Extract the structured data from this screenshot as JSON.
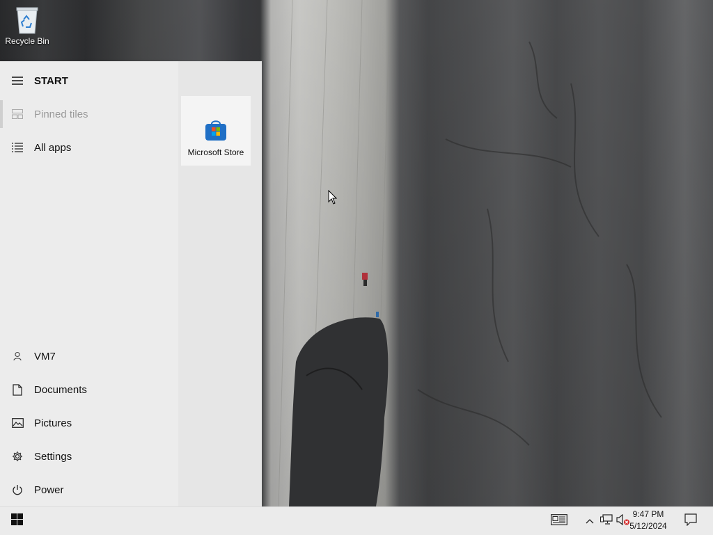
{
  "desktop": {
    "icons": [
      {
        "label": "Recycle Bin",
        "icon": "recycle-bin-icon"
      }
    ]
  },
  "start_menu": {
    "title": "START",
    "items_top": [
      {
        "label": "Pinned tiles",
        "icon": "tiles-icon",
        "state": "disabled"
      },
      {
        "label": "All apps",
        "icon": "list-icon"
      }
    ],
    "items_bottom": [
      {
        "label": "VM7",
        "icon": "user-icon"
      },
      {
        "label": "Documents",
        "icon": "document-icon"
      },
      {
        "label": "Pictures",
        "icon": "picture-icon"
      },
      {
        "label": "Settings",
        "icon": "gear-icon"
      },
      {
        "label": "Power",
        "icon": "power-icon"
      }
    ],
    "tiles": [
      {
        "label": "Microsoft Store",
        "icon": "microsoft-store-icon"
      }
    ]
  },
  "taskbar": {
    "tray_icons": [
      "news-icon",
      "chevron-up-icon",
      "network-icon",
      "volume-muted-icon",
      "notification-icon"
    ],
    "clock": {
      "time": "9:47 PM",
      "date": "5/12/2024"
    }
  },
  "colors": {
    "menu_background": "#ececec",
    "taskbar_background": "#ebebeb",
    "store_blue": "#1f6fc5"
  }
}
